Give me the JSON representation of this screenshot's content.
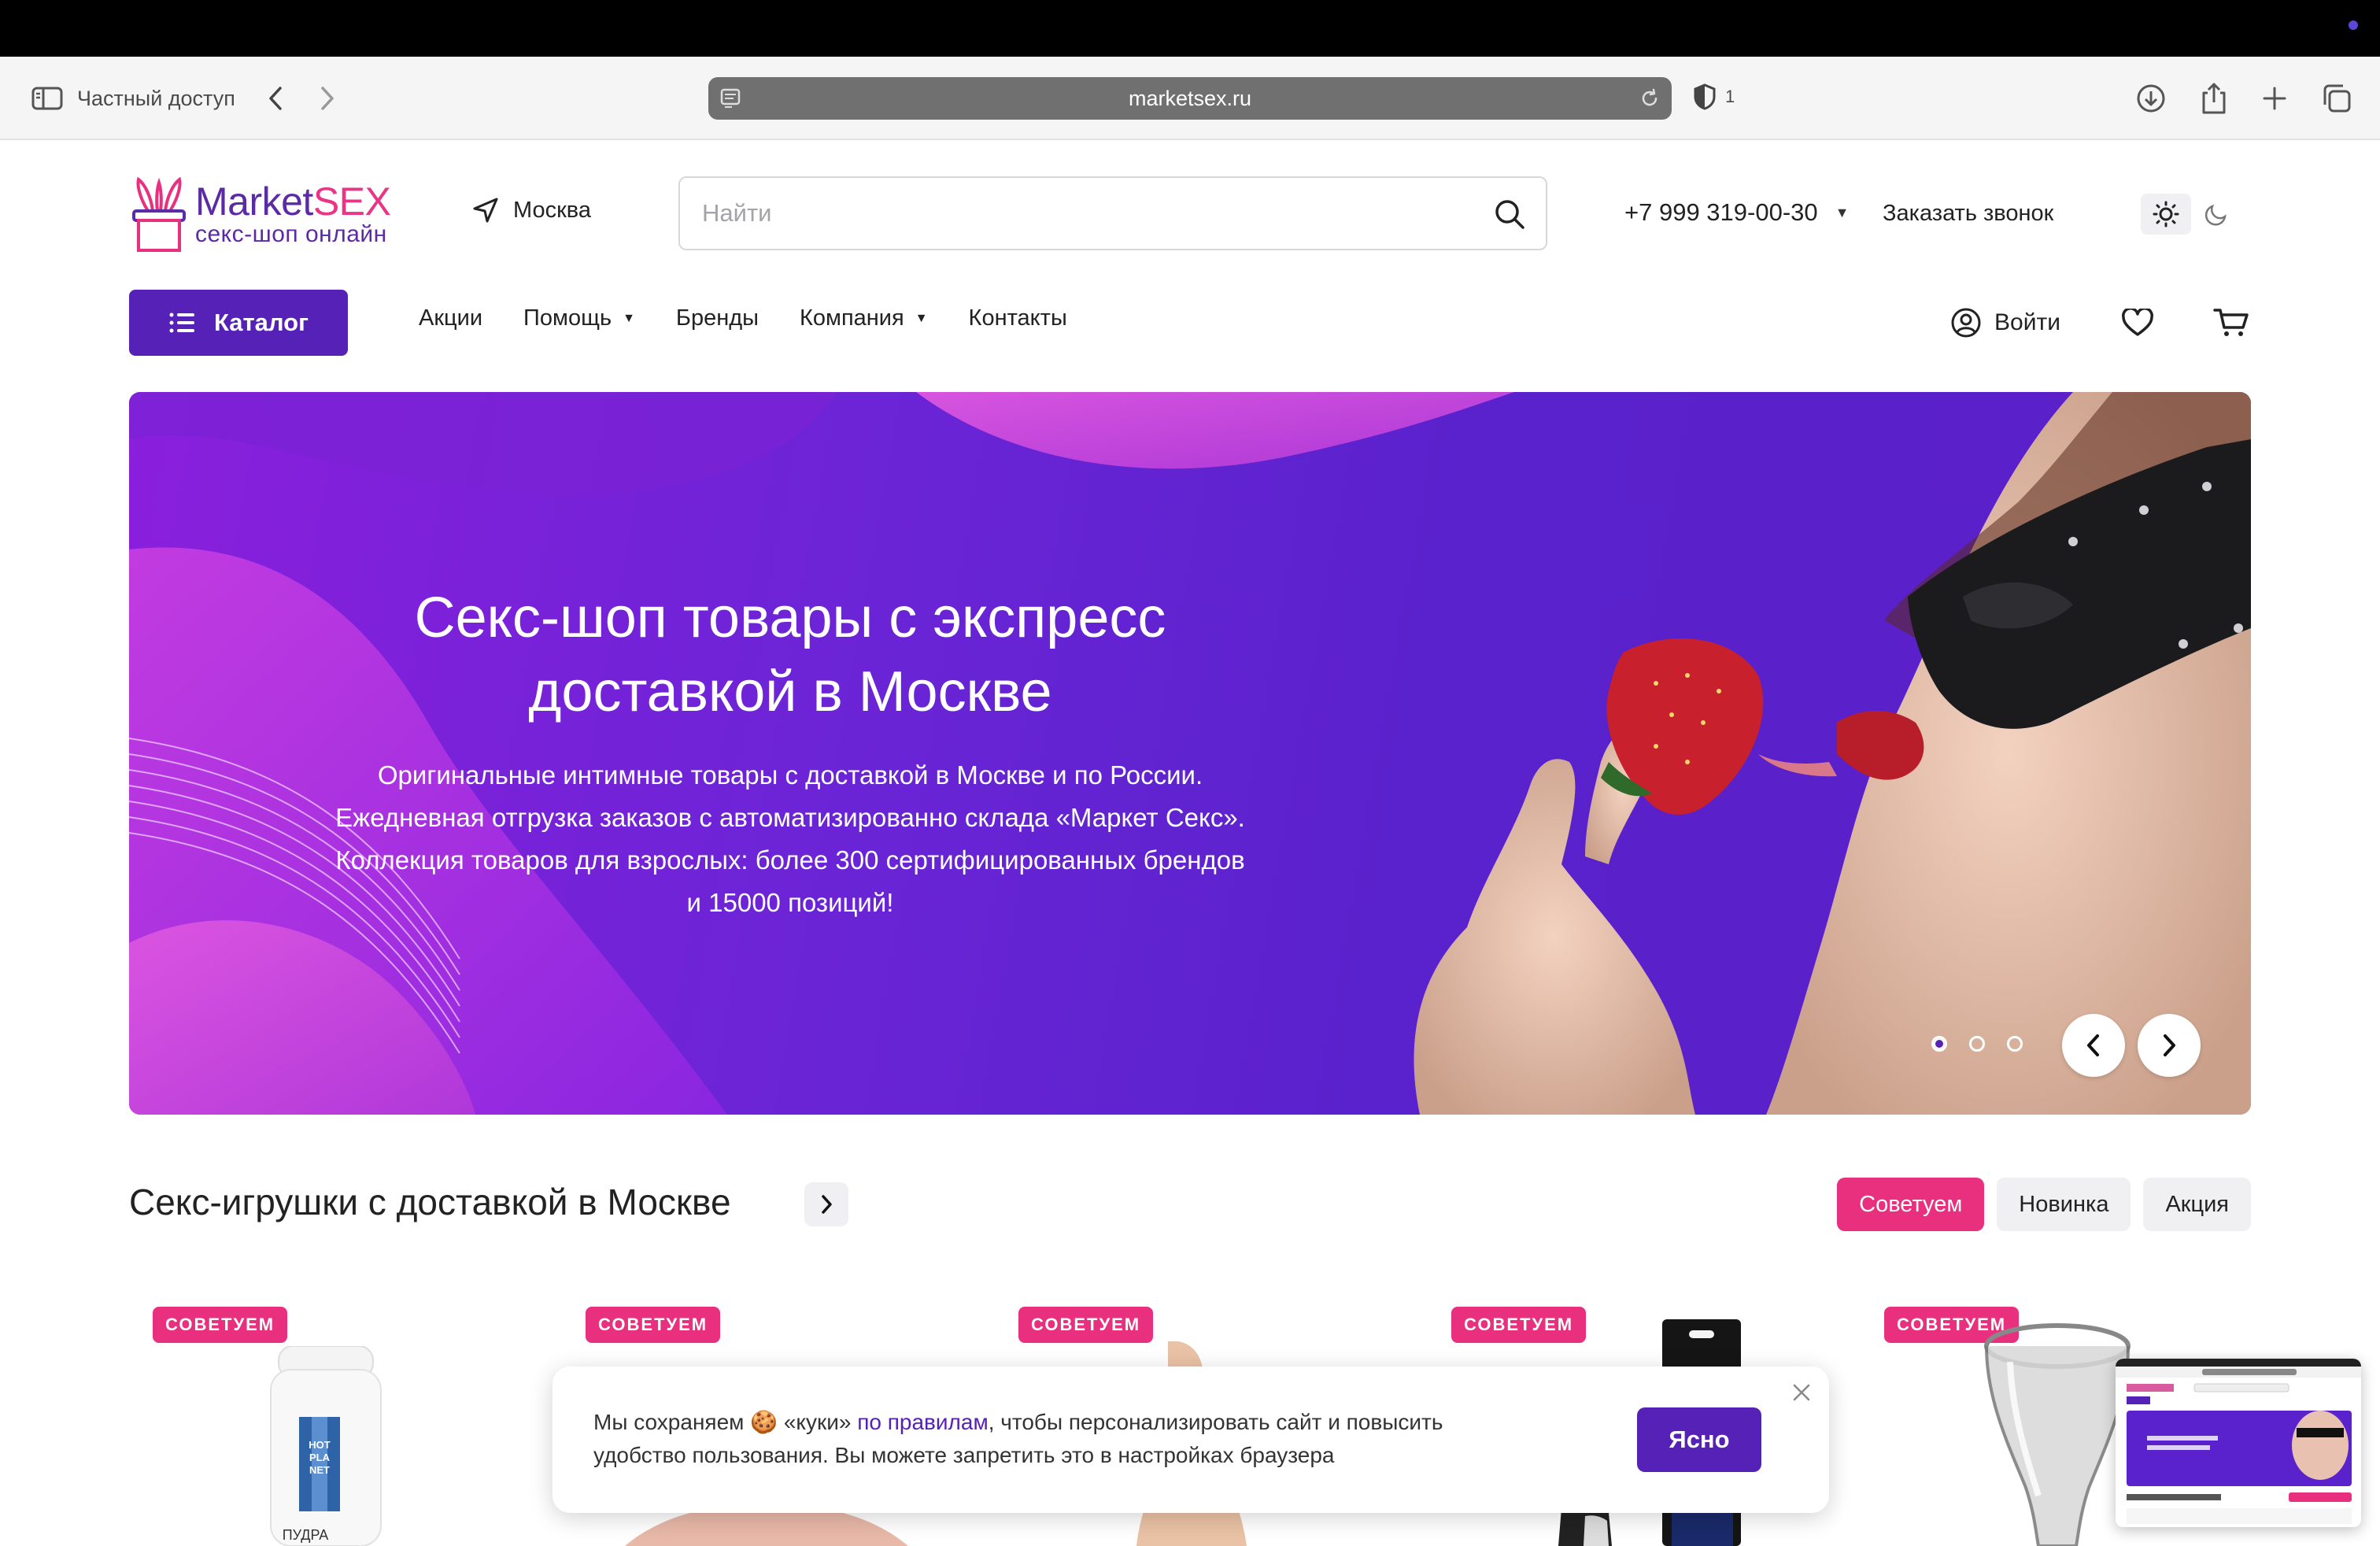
{
  "browser": {
    "sidebar_label": "Частный доступ",
    "url": "marketsex.ru",
    "shield_count": "1"
  },
  "header": {
    "logo_main_1": "Market",
    "logo_main_2": "SEX",
    "logo_sub": "секс-шоп онлайн",
    "city": "Москва",
    "search_placeholder": "Найти",
    "phone": "+7 999 319-00-30",
    "callback": "Заказать звонок"
  },
  "nav": {
    "catalog": "Каталог",
    "items": [
      {
        "label": "Акции"
      },
      {
        "label": "Помощь"
      },
      {
        "label": "Бренды"
      },
      {
        "label": "Компания"
      },
      {
        "label": "Контакты"
      }
    ],
    "login": "Войти"
  },
  "hero": {
    "title_line1": "Секс-шоп товары с экспресс",
    "title_line2": "доставкой в Москве",
    "text_line1": "Оригинальные интимные товары с доставкой в Москве и по России.",
    "text_line2": "Ежедневная отгрузка заказов с автоматизированно склада «Маркет Секс».",
    "text_line3": "Коллекция товаров для взрослых: более 300 сертифицированных брендов",
    "text_line4": "и 15000 позиций!",
    "slides": 3,
    "active_slide": 1
  },
  "section": {
    "title": "Секс-игрушки с доставкой в Москве",
    "filters": [
      "Советуем",
      "Новинка",
      "Акция"
    ]
  },
  "products": [
    {
      "badge": "СОВЕТУЕМ",
      "label_text": "ПУДРА",
      "bottle_text": "HOT PLA NET"
    },
    {
      "badge": "СОВЕТУЕМ"
    },
    {
      "badge": "СОВЕТУЕМ"
    },
    {
      "badge": "СОВЕТУЕМ"
    },
    {
      "badge": "СОВЕТУЕМ"
    }
  ],
  "cookie": {
    "text_before": "Мы сохраняем 🍪 «куки» ",
    "link": "по правилам",
    "text_after": ", чтобы персонализировать сайт и повысить",
    "text_line2": "удобство пользования. Вы можете запретить это в настройках браузера",
    "button": "Ясно"
  },
  "colors": {
    "brand_purple": "#5621b6",
    "brand_pink": "#e8307f"
  }
}
